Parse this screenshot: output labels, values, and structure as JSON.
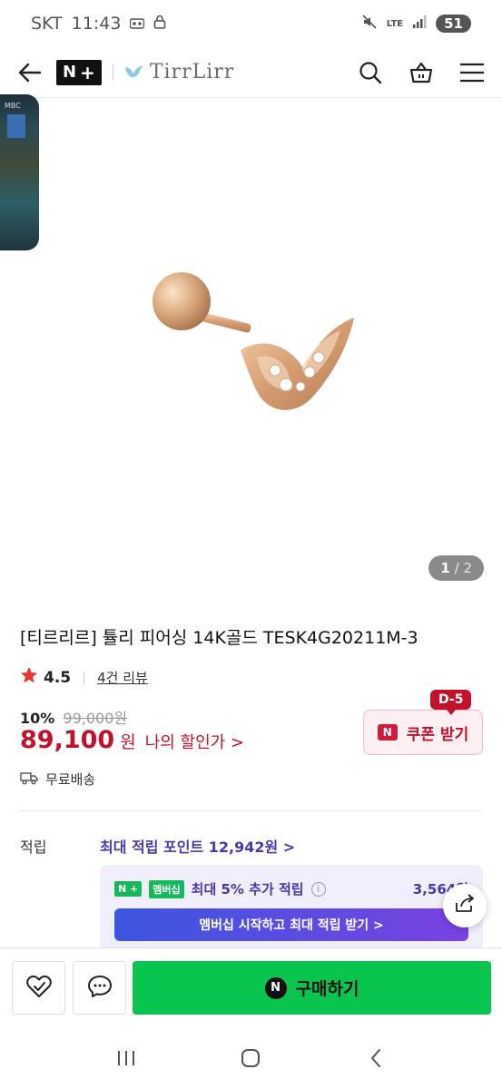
{
  "status_bar": {
    "carrier": "SKT",
    "time": "11:43",
    "network": "LTE",
    "battery": "51",
    "icons": [
      "voicemail-icon",
      "lock-icon",
      "mute-icon",
      "lte-icon",
      "signal-icon",
      "battery-icon"
    ]
  },
  "header": {
    "logo_n": "N",
    "logo_plus": "+",
    "brand_name": "TirrLirr",
    "icons": [
      "back-arrow-icon",
      "search-icon",
      "cart-icon",
      "menu-icon"
    ]
  },
  "pip": {
    "label": "MBC"
  },
  "image": {
    "current": "1",
    "separator": "/",
    "total": "2"
  },
  "product": {
    "title": "[티르리르] 튤리 피어싱 14K골드 TESK4G20211M-3",
    "rating": "4.5",
    "reviews": "4건 리뷰",
    "discount_rate": "10%",
    "original_price": "99,000원",
    "price": "89,100",
    "currency": "원",
    "my_price_label": "나의 할인가 >",
    "shipping": "무료배송"
  },
  "coupon": {
    "label": "쿠폰 받기",
    "badge": "N",
    "dday": "D-5"
  },
  "points": {
    "label": "적립",
    "max_label": "최대 적립 포인트 12,942원 >",
    "nplus_badge": "N +",
    "member_tag": "멤버십",
    "extra_label": "최대 5% 추가 적립",
    "info": "i",
    "extra_amount": "3,564원",
    "cta": "멤버십 시작하고 최대 적립 받기 >"
  },
  "bottom": {
    "buy_label": "구매하기",
    "buy_badge": "N"
  },
  "colors": {
    "accent_red": "#c2112d",
    "buy_green": "#09c44f",
    "points_purple": "#4a3aa6"
  }
}
